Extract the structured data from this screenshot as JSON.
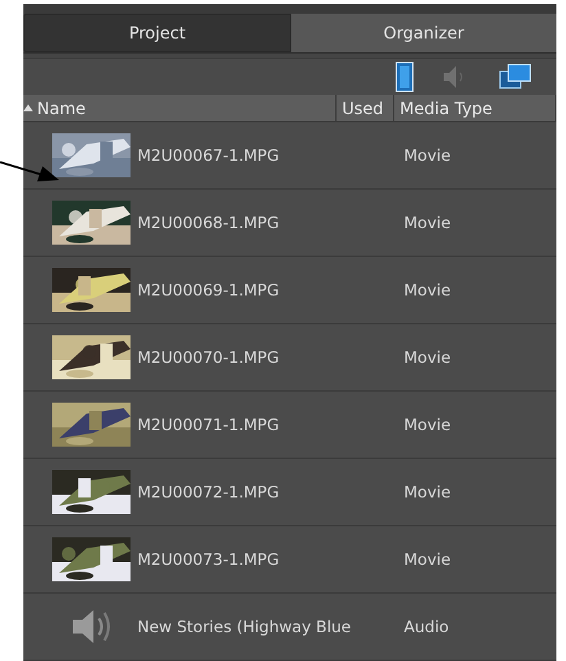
{
  "tabs": [
    {
      "label": "Project",
      "selected": true
    },
    {
      "label": "Organizer",
      "selected": false
    }
  ],
  "toolbar": {
    "buttons": [
      {
        "kind": "video",
        "on": true
      },
      {
        "kind": "audio",
        "on": false
      },
      {
        "kind": "display",
        "on": true
      }
    ]
  },
  "table": {
    "columns": [
      {
        "label": "Name",
        "sorted": true
      },
      {
        "label": "Used",
        "sorted": false
      },
      {
        "label": "Media Type",
        "sorted": false
      }
    ],
    "rows": [
      {
        "kind": "movie",
        "name": "M2U00067-1.MPG",
        "media_type": "Movie"
      },
      {
        "kind": "movie",
        "name": "M2U00068-1.MPG",
        "media_type": "Movie"
      },
      {
        "kind": "movie",
        "name": "M2U00069-1.MPG",
        "media_type": "Movie"
      },
      {
        "kind": "movie",
        "name": "M2U00070-1.MPG",
        "media_type": "Movie"
      },
      {
        "kind": "movie",
        "name": "M2U00071-1.MPG",
        "media_type": "Movie"
      },
      {
        "kind": "movie",
        "name": "M2U00072-1.MPG",
        "media_type": "Movie"
      },
      {
        "kind": "movie",
        "name": "M2U00073-1.MPG",
        "media_type": "Movie"
      },
      {
        "kind": "audio",
        "name": "New Stories (Highway Blue",
        "media_type": "Audio"
      }
    ]
  }
}
